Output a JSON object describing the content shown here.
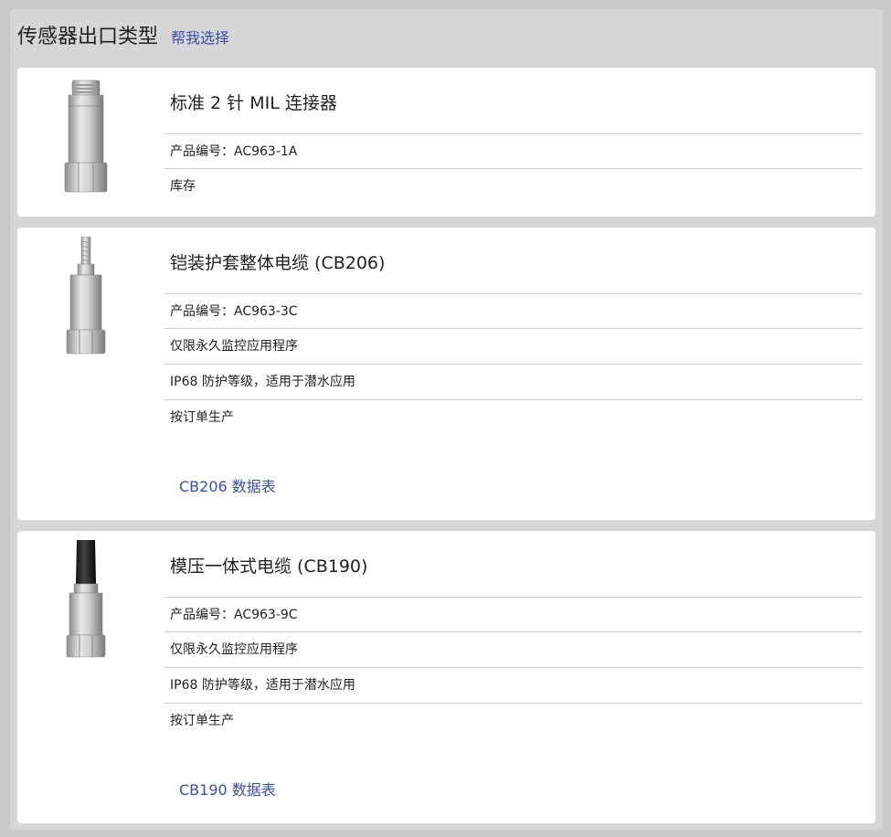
{
  "header": {
    "title": "传感器出口类型",
    "help_link": "帮我选择"
  },
  "products": [
    {
      "title": "标准 2 针 MIL 连接器",
      "rows": [
        "产品编号：AC963-1A",
        "库存"
      ],
      "image": "mil-connector-sensor-icon"
    },
    {
      "title": "铠装护套整体电缆 (CB206)",
      "rows": [
        "产品编号：AC963-3C",
        "仅限永久监控应用程序",
        "IP68 防护等级，适用于潜水应用",
        "按订单生产"
      ],
      "datasheet": "CB206 数据表",
      "image": "armored-cable-sensor-icon"
    },
    {
      "title": "模压一体式电缆 (CB190)",
      "rows": [
        "产品编号：AC963-9C",
        "仅限永久监控应用程序",
        "IP68 防护等级，适用于潜水应用",
        "按订单生产"
      ],
      "datasheet": "CB190 数据表",
      "image": "molded-cable-sensor-icon"
    }
  ]
}
